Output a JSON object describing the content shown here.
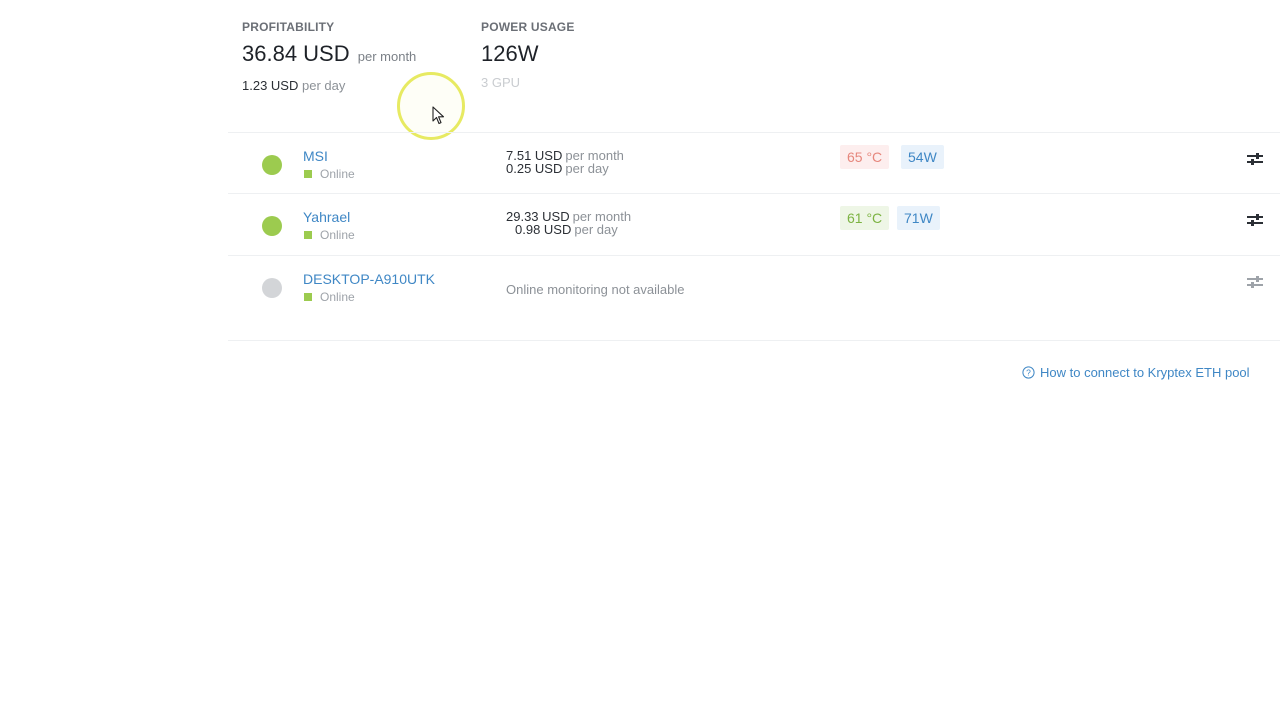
{
  "summary": {
    "profitability": {
      "label": "PROFITABILITY",
      "monthly_value": "36.84 USD",
      "monthly_unit": "per month",
      "daily_value": "1.23 USD",
      "daily_unit": "per day"
    },
    "power_usage": {
      "label": "POWER USAGE",
      "value": "126W",
      "sub": "3 GPU"
    }
  },
  "rigs": [
    {
      "name": "MSI",
      "status": "Online",
      "indicator_color": "#9ccb4f",
      "monthly_value": "7.51 USD",
      "monthly_unit": "per month",
      "daily_value": "0.25 USD",
      "daily_unit": "per day",
      "temperature": "65 °C",
      "power": "54W"
    },
    {
      "name": "Yahrael",
      "status": "Online",
      "indicator_color": "#9ccb4f",
      "monthly_value": "29.33 USD",
      "monthly_unit": "per month",
      "daily_value": "0.98 USD",
      "daily_unit": "per day",
      "temperature": "61 °C",
      "power": "71W"
    },
    {
      "name": "DESKTOP-A910UTK",
      "status": "Online",
      "indicator_color": "#d3d5d8",
      "note": "Online monitoring not available"
    }
  ],
  "help_link": {
    "label": "How to connect to Kryptex ETH pool",
    "icon": "question-circle-icon"
  },
  "colors": {
    "accent_blue": "#3f87c5",
    "online_green": "#9ccb4f",
    "temp_hot": "#e6877d",
    "temp_ok": "#7cb342",
    "cursor_highlight": "#e7ea62"
  }
}
